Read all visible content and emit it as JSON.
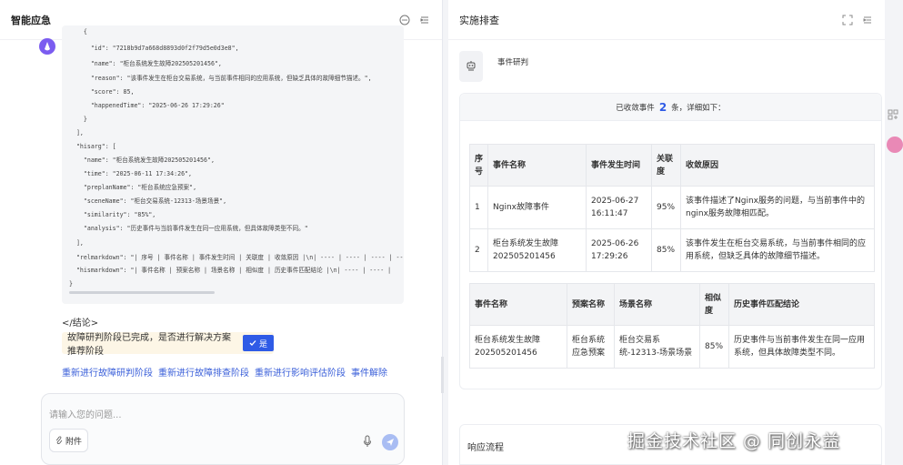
{
  "left": {
    "title": "智能应急",
    "code_lines": [
      "    {",
      "      \"id\": \"7218b9d7a668d8893d0f2f79d5e0d3e8\",",
      "      \"name\": \"柜台系统发生故障202505201456\",",
      "      \"reason\": \"该事件发生在柜台交易系统，与当前事件相同的应用系统，但缺乏具体的故障细节描述。\",",
      "      \"score\": 85,",
      "      \"happenedTime\": \"2025-06-26 17:29:26\"",
      "    }",
      "  ],",
      "  \"hisarg\": [",
      "    \"name\": \"柜台系统发生故障202505201456\",",
      "    \"time\": \"2025-06-11 17:34:26\",",
      "    \"preplanName\": \"柜台系统应急预案\",",
      "    \"sceneName\": \"柜台交易系统-12313-场景场景\",",
      "    \"similarity\": \"85%\",",
      "    \"analysis\": \"历史事件与当前事件发生在同一应用系统，但具体故障类型不同。\"",
      "  ],",
      "  \"relmarkdown\": \"| 序号 | 事件名称 | 事件发生时间 | 关联度 | 收敛原因 |\\n| ---- | ---- | ---- | ---- |",
      "  \"hismarkdown\": \"| 事件名称 | 预案名称 | 场景名称 | 相似度 | 历史事件匹配结论 |\\n| ---- | ---- |",
      "}"
    ],
    "end_tag": "</结论>",
    "confirm_text": "故障研判阶段已完成，是否进行解决方案推荐阶段",
    "yes_label": "是",
    "links": [
      "重新进行故障研判阶段",
      "重新进行故障排查阶段",
      "重新进行影响评估阶段",
      "事件解除"
    ],
    "input_placeholder": "请输入您的问题...",
    "attach_label": "附件"
  },
  "right": {
    "title": "实施排查",
    "step_name": "事件研判",
    "summary_prefix": "已收敛事件",
    "summary_count": "2",
    "summary_suffix": "条，详细如下：",
    "table1": {
      "headers": [
        "序号",
        "事件名称",
        "事件发生时间",
        "关联度",
        "收敛原因"
      ],
      "rows": [
        [
          "1",
          "Nginx故障事件",
          "2025-06-27 16:11:47",
          "95%",
          "该事件描述了Nginx服务的问题，与当前事件中的nginx服务故障相匹配。"
        ],
        [
          "2",
          "柜台系统发生故障202505201456",
          "2025-06-26 17:29:26",
          "85%",
          "该事件发生在柜台交易系统，与当前事件相同的应用系统，但缺乏具体的故障细节描述。"
        ]
      ]
    },
    "table2": {
      "headers": [
        "事件名称",
        "预案名称",
        "场景名称",
        "相似度",
        "历史事件匹配结论"
      ],
      "rows": [
        [
          "柜台系统发生故障202505201456",
          "柜台系统应急预案",
          "柜台交易系统-12313-场景场景",
          "85%",
          "历史事件与当前事件发生在同一应用系统，但具体故障类型不同。"
        ]
      ]
    },
    "flow_title": "响应流程"
  },
  "watermark": "掘金技术社区 @ 同创永益",
  "colors": {
    "accent": "#2f5be6",
    "link": "#3a5fd9",
    "avatar": "#7b5cf0",
    "confirm_bg": "#fdf6e6"
  }
}
